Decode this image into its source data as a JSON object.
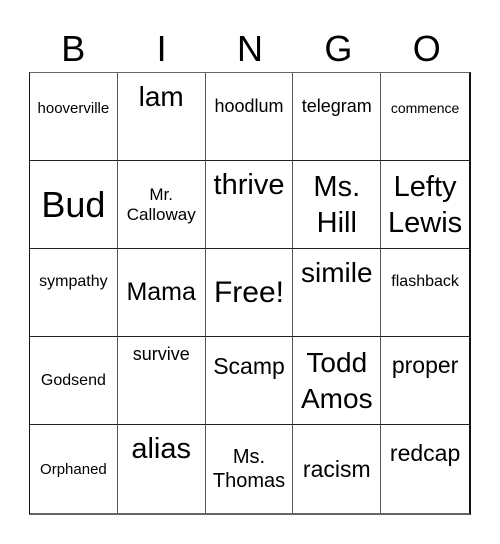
{
  "header": {
    "letters": [
      "B",
      "I",
      "N",
      "G",
      "O"
    ]
  },
  "grid": {
    "rows": [
      [
        "hooverville",
        "lam",
        "hoodlum",
        "telegram",
        "commence"
      ],
      [
        "Bud",
        "Mr. Calloway",
        "thrive",
        "Ms. Hill",
        "Lefty Lewis"
      ],
      [
        "sympathy",
        "Mama",
        "Free!",
        "simile",
        "flashback"
      ],
      [
        "Godsend",
        "survive",
        "Scamp",
        "Todd Amos",
        "proper"
      ],
      [
        "Orphaned",
        "alias",
        "Ms. Thomas",
        "racism",
        "redcap"
      ]
    ],
    "free_space": "Free!"
  }
}
